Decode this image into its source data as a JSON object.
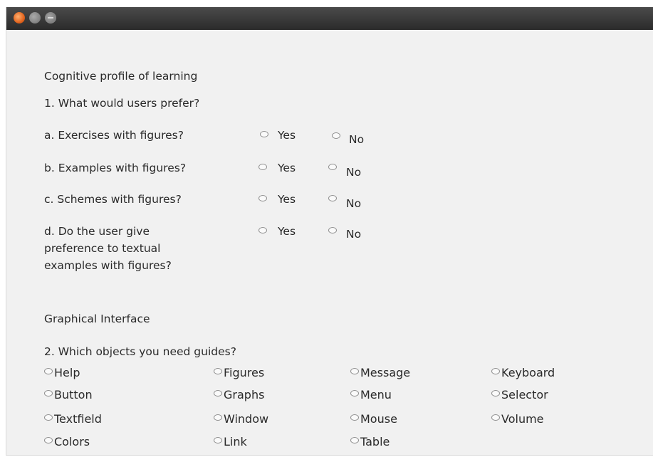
{
  "section1": {
    "title": "Cognitive profile of learning",
    "question": "1. What would users prefer?",
    "yes_label": "Yes",
    "no_label": "No",
    "items": [
      {
        "text": "a. Exercises with figures?"
      },
      {
        "text": "b. Examples with figures?"
      },
      {
        "text": "c. Schemes with figures?"
      },
      {
        "text": "d. Do the user give preference to textual examples with figures?"
      }
    ]
  },
  "section2": {
    "title": "Graphical Interface",
    "question": "2. Which objects you need guides?",
    "options": [
      "Help",
      "Figures",
      "Message",
      "Keyboard",
      "Button",
      "Graphs",
      "Menu",
      "Selector",
      "Textfield",
      "Window",
      "Mouse",
      "Volume",
      "Colors",
      "Link",
      "Table"
    ]
  }
}
